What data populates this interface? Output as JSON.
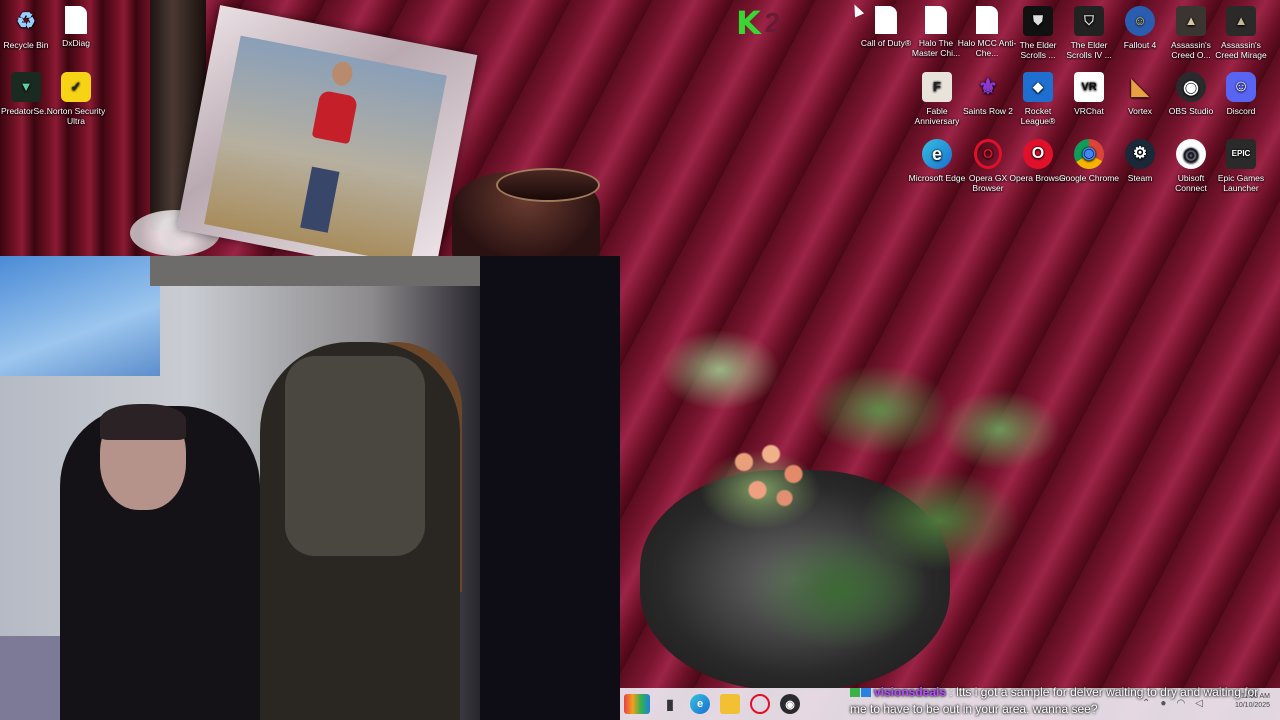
{
  "desktop": {
    "icons_left": [
      {
        "label": "Recycle Bin",
        "icon": "recycle-bin-icon"
      },
      {
        "label": "DxDiag",
        "icon": "document-icon"
      },
      {
        "label": "PredatorSe...",
        "icon": "predator-sense-icon"
      },
      {
        "label": "Norton Security Ultra",
        "icon": "norton-icon"
      }
    ],
    "icons_right_row1": [
      {
        "label": "Call of Duty®",
        "icon": "document-icon"
      },
      {
        "label": "Halo The Master Chi...",
        "icon": "document-icon"
      },
      {
        "label": "Halo MCC Anti-Che...",
        "icon": "document-icon"
      },
      {
        "label": "The Elder Scrolls ...",
        "icon": "elder-scrolls-icon"
      },
      {
        "label": "The Elder Scrolls IV ...",
        "icon": "elder-scrolls-iv-icon"
      },
      {
        "label": "Fallout 4",
        "icon": "fallout-icon"
      },
      {
        "label": "Assassin's Creed O...",
        "icon": "assassins-creed-icon"
      },
      {
        "label": "Assassin's Creed Mirage",
        "icon": "assassins-creed-icon"
      }
    ],
    "icons_right_row2": [
      {
        "label": "Fable Anniversary",
        "icon": "fable-icon",
        "glyph": "F"
      },
      {
        "label": "Saints Row 2",
        "icon": "saints-row-icon",
        "glyph": "⚜"
      },
      {
        "label": "Rocket League®",
        "icon": "rocket-league-icon",
        "glyph": "◆"
      },
      {
        "label": "VRChat",
        "icon": "vrchat-icon",
        "glyph": "VR"
      },
      {
        "label": "Vortex",
        "icon": "vortex-icon",
        "glyph": "◣"
      },
      {
        "label": "OBS Studio",
        "icon": "obs-icon",
        "glyph": "◉"
      },
      {
        "label": "Discord",
        "icon": "discord-icon",
        "glyph": "☺"
      }
    ],
    "icons_right_row3": [
      {
        "label": "Microsoft Edge",
        "icon": "edge-icon",
        "glyph": "e"
      },
      {
        "label": "Opera GX Browser",
        "icon": "opera-gx-icon",
        "glyph": "O"
      },
      {
        "label": "Opera Browser",
        "icon": "opera-icon",
        "glyph": "O"
      },
      {
        "label": "Google Chrome",
        "icon": "chrome-icon",
        "glyph": "◉"
      },
      {
        "label": "Steam",
        "icon": "steam-icon",
        "glyph": "⚙"
      },
      {
        "label": "Ubisoft Connect",
        "icon": "ubisoft-icon",
        "glyph": "◎"
      },
      {
        "label": "Epic Games Launcher",
        "icon": "epic-games-icon",
        "glyph": "EPIC"
      }
    ]
  },
  "overlay_logo": {
    "k": "K",
    "two": "2"
  },
  "chat": {
    "username": "visionsdeals",
    "separator": " : ",
    "message": "ltts i got a sample for delver waiting to dry and waiting for me to have to be out in your area. wanna see?"
  },
  "taskbar": {
    "apps": [
      "widgets-icon",
      "task-view-icon",
      "edge-icon",
      "file-explorer-icon",
      "opera-icon",
      "obs-icon"
    ],
    "time": "11:08 AM",
    "date": "10/10/2025"
  },
  "colors": {
    "accent_green": "#39d633",
    "chat_user": "#b84cff"
  }
}
